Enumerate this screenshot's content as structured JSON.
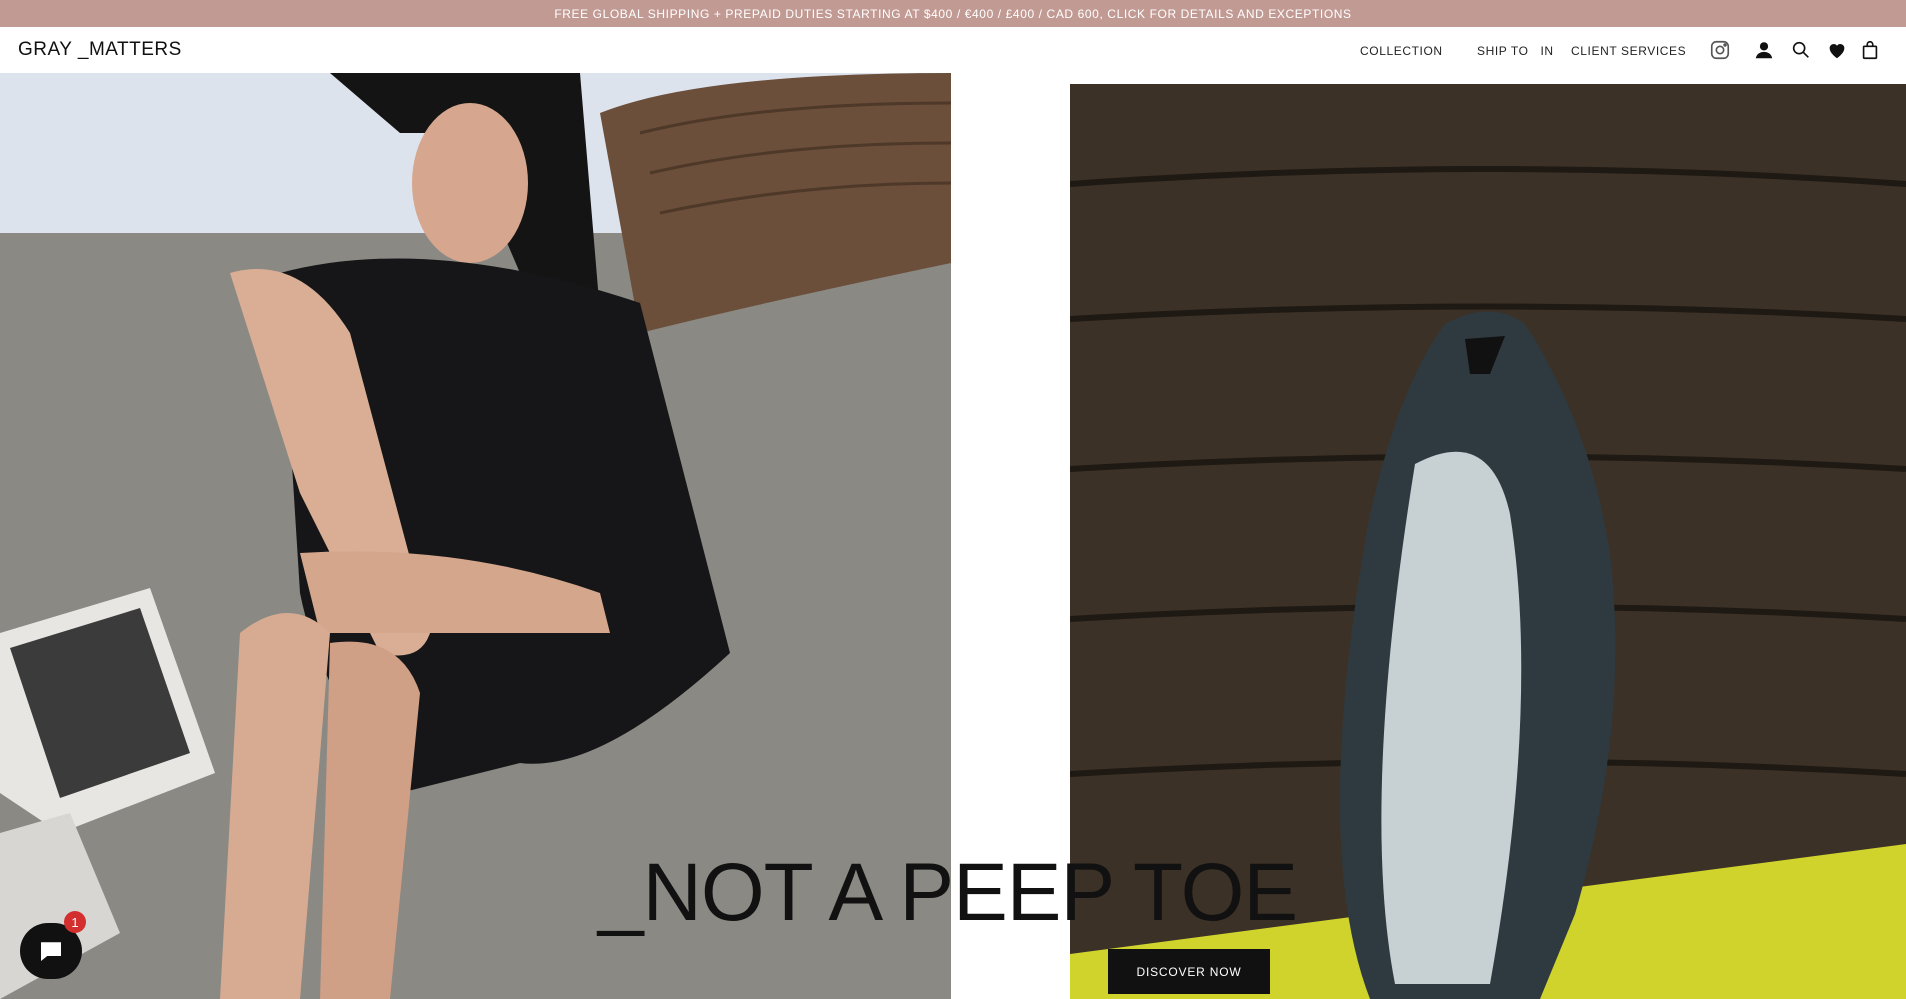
{
  "announcement": "FREE GLOBAL SHIPPING + PREPAID DUTIES STARTING AT $400 / €400 / £400 / CAD 600, CLICK FOR DETAILS AND EXCEPTIONS",
  "brand": "GRAY _MATTERS",
  "nav": {
    "collection": "COLLECTION",
    "ship_to": "SHIP TO",
    "ship_to_value": "IN",
    "client_services": "CLIENT SERVICES"
  },
  "icons": [
    "instagram-icon",
    "account-icon",
    "search-icon",
    "wishlist-icon",
    "bag-icon",
    "chat-icon"
  ],
  "hero": {
    "headline": "_NOT A PEEP TOE",
    "cta": "DISCOVER NOW"
  },
  "chat": {
    "badge": "1"
  },
  "colors": {
    "announcement_bg": "#c29a94",
    "announcement_text": "#ffffff",
    "cta_bg": "#111111",
    "badge": "#d32f2f"
  }
}
